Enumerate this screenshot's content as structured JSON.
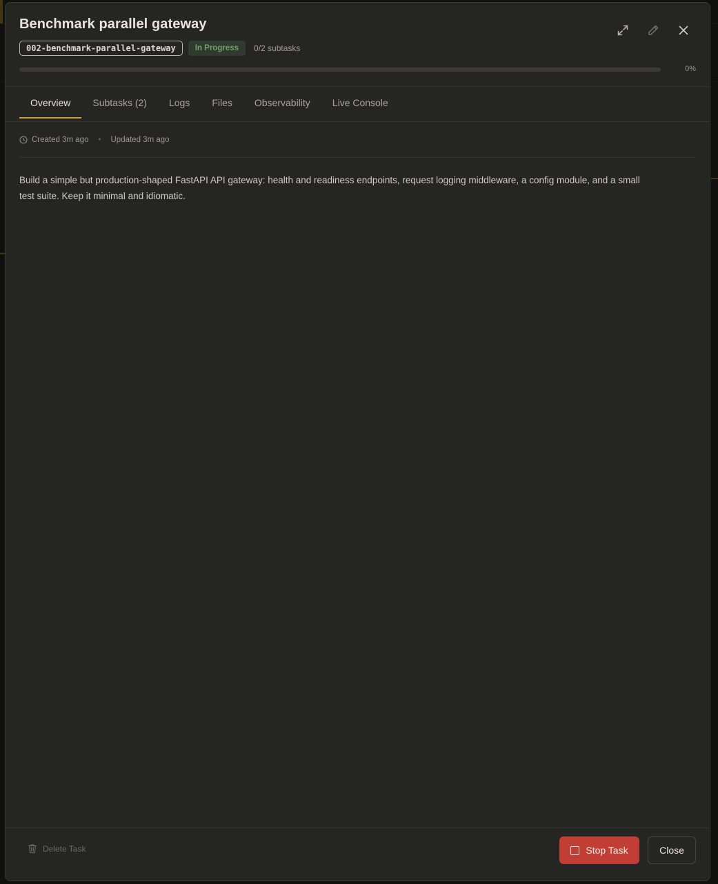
{
  "task": {
    "title": "Benchmark parallel gateway",
    "id": "002-benchmark-parallel-gateway",
    "status": "In Progress",
    "subtask_summary": "0/2 subtasks",
    "progress_label": "0%",
    "progress_value": 0
  },
  "header_actions": {
    "expand_icon": "expand-icon",
    "edit_icon": "pencil-icon",
    "close_icon": "close-icon"
  },
  "tabs": [
    {
      "label": "Overview",
      "active": true
    },
    {
      "label": "Subtasks (2)",
      "active": false
    },
    {
      "label": "Logs",
      "active": false
    },
    {
      "label": "Files",
      "active": false
    },
    {
      "label": "Observability",
      "active": false
    },
    {
      "label": "Live Console",
      "active": false
    }
  ],
  "overview": {
    "created": "Created 3m ago",
    "separator": "•",
    "updated": "Updated 3m ago",
    "description": "Build a simple but production-shaped FastAPI API gateway: health and readiness endpoints, request logging middleware, a config module, and a small test suite. Keep it minimal and idiomatic."
  },
  "footer": {
    "delete_label": "Delete Task",
    "stop_label": "Stop Task",
    "close_label": "Close"
  },
  "colors": {
    "accent": "#c9a13c",
    "status_green": "#6fa36a",
    "danger": "#c23d33",
    "surface": "#252523"
  }
}
